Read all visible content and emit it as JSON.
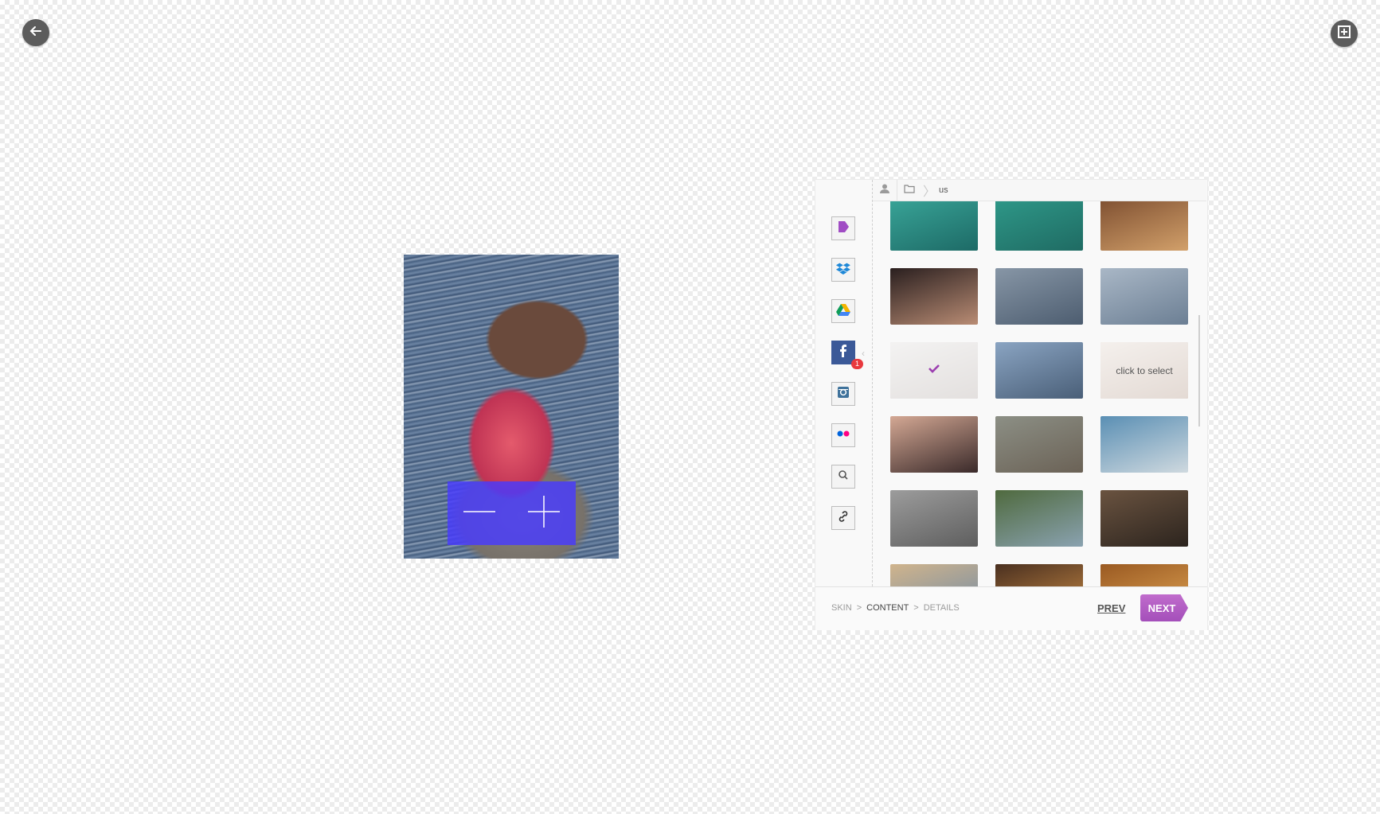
{
  "toolbar": {
    "back_icon": "arrow-left-icon",
    "fit_icon": "fit-frame-icon"
  },
  "preview": {
    "zoom_out_icon": "minus-icon",
    "zoom_in_icon": "plus-icon"
  },
  "sources": [
    {
      "name": "tag-source",
      "icon": "tag-icon",
      "color": "#a04cc4"
    },
    {
      "name": "dropbox-source",
      "icon": "dropbox-icon",
      "color": "#1e88d8"
    },
    {
      "name": "drive-source",
      "icon": "drive-icon",
      "color": "#0f9d58"
    },
    {
      "name": "facebook-source",
      "icon": "facebook-icon",
      "color": "#3b5998",
      "badge": "1"
    },
    {
      "name": "instagram-source",
      "icon": "instagram-icon",
      "color": "#3f729b"
    },
    {
      "name": "flickr-source",
      "icon": "flickr-icon",
      "color": "#ff0084"
    },
    {
      "name": "search-source",
      "icon": "search-icon",
      "color": "#555555"
    },
    {
      "name": "link-source",
      "icon": "link-icon",
      "color": "#444444"
    }
  ],
  "breadcrumb": {
    "folder": "us"
  },
  "gallery": {
    "hint": "click to select",
    "photos": [
      {
        "colors": [
          "#3aa79a",
          "#1d6a66"
        ]
      },
      {
        "colors": [
          "#2f9a8a",
          "#1f6b63"
        ]
      },
      {
        "colors": [
          "#7a4b2e",
          "#d2a06a"
        ]
      },
      {
        "colors": [
          "#2a1f1f",
          "#b98c74"
        ]
      },
      {
        "colors": [
          "#8796a6",
          "#4d5d70"
        ]
      },
      {
        "colors": [
          "#a9b7c6",
          "#6c7f94"
        ]
      },
      {
        "colors": [
          "#d5d2d0",
          "#9b8f8a"
        ],
        "selected": true
      },
      {
        "colors": [
          "#8aa4c2",
          "#4a5f78"
        ]
      },
      {
        "colors": [
          "#d8c9bd",
          "#9c7a65"
        ],
        "hint": true
      },
      {
        "colors": [
          "#d4a894",
          "#3a2a2a"
        ]
      },
      {
        "colors": [
          "#8c8f85",
          "#6b6256"
        ]
      },
      {
        "colors": [
          "#5a8fb4",
          "#cfd9df"
        ]
      },
      {
        "colors": [
          "#9c9c9c",
          "#5e5e5e"
        ]
      },
      {
        "colors": [
          "#4f6a3e",
          "#8aa2b0"
        ]
      },
      {
        "colors": [
          "#6a5340",
          "#2c241e"
        ]
      },
      {
        "colors": [
          "#d0b48c",
          "#6f8aa6"
        ]
      },
      {
        "colors": [
          "#4a3020",
          "#c98a44"
        ]
      },
      {
        "colors": [
          "#9a5a22",
          "#e0a454"
        ]
      }
    ]
  },
  "footer": {
    "steps": [
      "SKIN",
      "CONTENT",
      "DETAILS"
    ],
    "separator": ">",
    "prev_label": "PREV",
    "next_label": "NEXT"
  }
}
